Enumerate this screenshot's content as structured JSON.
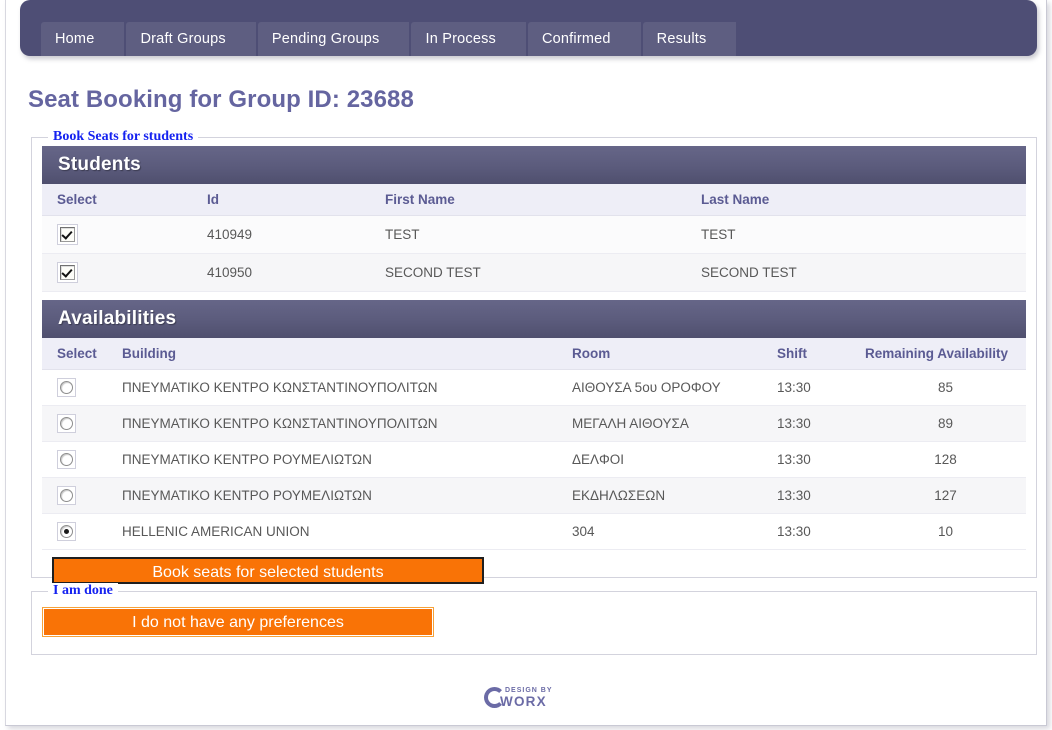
{
  "nav": {
    "tabs": [
      {
        "label": "Home"
      },
      {
        "label": "Draft Groups"
      },
      {
        "label": "Pending Groups"
      },
      {
        "label": "In Process"
      },
      {
        "label": "Confirmed"
      },
      {
        "label": "Results"
      }
    ]
  },
  "page": {
    "title": "Seat Booking for Group ID: 23688"
  },
  "book_fieldset": {
    "legend": "Book Seats for students",
    "students": {
      "banner": "Students",
      "columns": [
        "Select",
        "Id",
        "First Name",
        "Last Name"
      ],
      "rows": [
        {
          "selected": true,
          "id": "410949",
          "first_name": "TEST",
          "last_name": "TEST"
        },
        {
          "selected": true,
          "id": "410950",
          "first_name": "SECOND TEST",
          "last_name": "SECOND TEST"
        }
      ]
    },
    "availabilities": {
      "banner": "Availabilities",
      "columns": [
        "Select",
        "Building",
        "Room",
        "Shift",
        "Remaining Availability"
      ],
      "rows": [
        {
          "selected": false,
          "building": "ΠΝΕΥΜΑΤΙΚΟ ΚΕΝΤΡΟ ΚΩΝΣΤΑΝΤΙΝΟΥΠΟΛΙΤΩΝ",
          "room": "ΑΙΘΟΥΣΑ 5ου ΟΡΟΦΟΥ",
          "shift": "13:30",
          "remaining": "85"
        },
        {
          "selected": false,
          "building": "ΠΝΕΥΜΑΤΙΚΟ ΚΕΝΤΡΟ ΚΩΝΣΤΑΝΤΙΝΟΥΠΟΛΙΤΩΝ",
          "room": "ΜΕΓΑΛΗ ΑΙΘΟΥΣΑ",
          "shift": "13:30",
          "remaining": "89"
        },
        {
          "selected": false,
          "building": "ΠΝΕΥΜΑΤΙΚΟ ΚΕΝΤΡΟ ΡΟΥΜΕΛΙΩΤΩΝ",
          "room": "ΔΕΛΦΟΙ",
          "shift": "13:30",
          "remaining": "128"
        },
        {
          "selected": false,
          "building": "ΠΝΕΥΜΑΤΙΚΟ ΚΕΝΤΡΟ ΡΟΥΜΕΛΙΩΤΩΝ",
          "room": "ΕΚΔΗΛΩΣΕΩΝ",
          "shift": "13:30",
          "remaining": "127"
        },
        {
          "selected": true,
          "building": "HELLENIC AMERICAN UNION",
          "room": "304",
          "shift": "13:30",
          "remaining": "10"
        }
      ]
    },
    "book_button": "Book seats for selected students"
  },
  "done_fieldset": {
    "legend": "I am done",
    "no_preferences_button": "I do not have any preferences"
  },
  "footer": {
    "logo_top": "DESIGN BY",
    "logo_bottom": "WORX"
  },
  "colors": {
    "navbar": "#4e4e75",
    "tab": "#5e5e81",
    "title": "#6565a0",
    "legend": "#1522f0",
    "banner": "#5b5b7c",
    "header_row": "#eeeef7",
    "header_text": "#5b5b93",
    "accent_orange": "#f97306",
    "logo": "#6b6ba6"
  }
}
